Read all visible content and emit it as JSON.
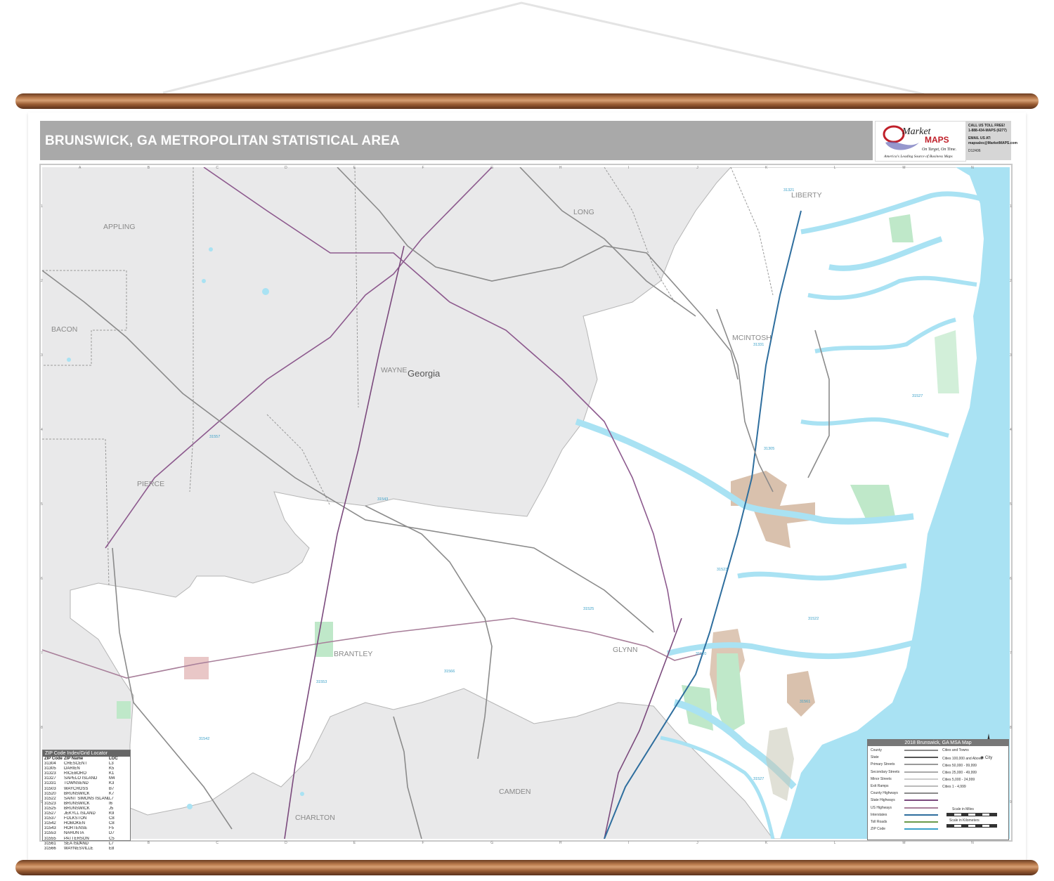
{
  "title": "BRUNSWICK, GA METROPOLITAN STATISTICAL AREA",
  "logo": {
    "brand_top": "Market",
    "brand_bottom": "MAPS",
    "tagline": "On Target, On Time.",
    "subtagline": "America's Leading Source of Business Maps"
  },
  "contact": {
    "line1": "CALL US TOLL FREE!",
    "line2": "1-888-434-MAPS (6277)",
    "line3": "EMAIL US AT:",
    "line4": "mapsales@MarketMAPS.com",
    "line5": "D12406"
  },
  "state_label": "Georgia",
  "county_labels": [
    "APPLING",
    "BACON",
    "PIERCE",
    "WAYNE",
    "LONG",
    "LIBERTY",
    "MCINTOSH",
    "BRANTLEY",
    "GLYNN",
    "CAMDEN",
    "CHARLTON"
  ],
  "zip_labels": [
    "31321",
    "31331",
    "31305",
    "31527",
    "31520",
    "31523",
    "31525",
    "31522",
    "31561",
    "31527",
    "31543",
    "31557",
    "31553",
    "31566",
    "31542",
    "31555"
  ],
  "grid_columns": [
    "A",
    "B",
    "C",
    "D",
    "E",
    "F",
    "G",
    "H",
    "I",
    "J",
    "K",
    "L",
    "M",
    "N"
  ],
  "grid_rows": [
    "1",
    "2",
    "3",
    "4",
    "5",
    "6",
    "7",
    "8",
    "9"
  ],
  "zip_index": {
    "heading": "ZIP Code Index/Grid Locator",
    "columns": [
      "ZIP Code",
      "ZIP Name",
      "LOC"
    ],
    "rows": [
      [
        "31304",
        "CRESCENT",
        "L3"
      ],
      [
        "31305",
        "DARIEN",
        "K5"
      ],
      [
        "31323",
        "RICEBORO",
        "K1"
      ],
      [
        "31327",
        "SAPELO ISLAND",
        "M4"
      ],
      [
        "31331",
        "TOWNSEND",
        "K3"
      ],
      [
        "31503",
        "WAYCROSS",
        "B7"
      ],
      [
        "31520",
        "BRUNSWICK",
        "K7"
      ],
      [
        "31522",
        "SAINT SIMONS ISLAND",
        "L7"
      ],
      [
        "31523",
        "BRUNSWICK",
        "I6"
      ],
      [
        "31525",
        "BRUNSWICK",
        "J5"
      ],
      [
        "31527",
        "JEKYLL ISLAND",
        "K9"
      ],
      [
        "31537",
        "FOLKSTON",
        "C8"
      ],
      [
        "31542",
        "HOBOKEN",
        "C8"
      ],
      [
        "31543",
        "HORTENSE",
        "F5"
      ],
      [
        "31553",
        "NAHUNTA",
        "D7"
      ],
      [
        "31555",
        "PATTERSON",
        "C5"
      ],
      [
        "31561",
        "SEA ISLAND",
        "L7"
      ],
      [
        "31566",
        "WAYNESVILLE",
        "E8"
      ]
    ]
  },
  "legend": {
    "title": "2018 Brunswick, GA MSA Map",
    "left_items": [
      "County",
      "State",
      "Primary Streets",
      "Secondary Streets",
      "Minor Streets",
      "Exit Ramps",
      "County Highways",
      "State Highways",
      "US Highways",
      "Interstates",
      "Toll Roads",
      "ZIP Code"
    ],
    "right_heading": "Cities and Towns",
    "right_items": [
      "Cities 100,000 and Above",
      "Cities 50,000 - 99,999",
      "Cities 25,000 - 49,999",
      "Cities 5,000 - 24,999",
      "Cities 1 - 4,999"
    ],
    "city_symbol_label": "City",
    "scale_miles": "Scale in Miles",
    "scale_km": "Scale in Kilometers"
  },
  "colors": {
    "water": "#a9e2f3",
    "outside_counties": "#e9e9ea",
    "msa_counties": "#ffffff",
    "urban": "#d9c1ad",
    "parks": "#bfe8c9",
    "header": "#a9a9a9",
    "rod": "#a76b42"
  }
}
